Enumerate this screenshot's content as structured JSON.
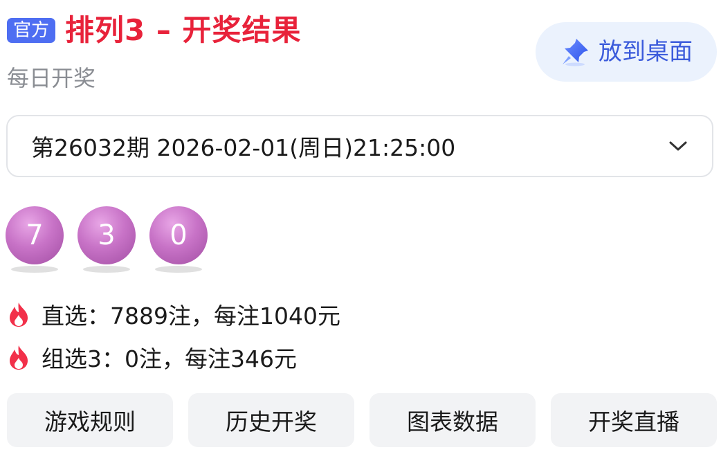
{
  "header": {
    "badge": "官方",
    "title": "排列3 – 开奖结果",
    "subtitle": "每日开奖"
  },
  "pin_button": {
    "label": "放到桌面",
    "icon": "pushpin-icon"
  },
  "issue_select": {
    "value": "第26032期 2026-02-01(周日)21:25:00",
    "icon": "chevron-down-icon"
  },
  "balls": [
    "7",
    "3",
    "0"
  ],
  "prizes": [
    {
      "icon": "fire-icon",
      "text": "直选：7889注，每注1040元"
    },
    {
      "icon": "fire-icon",
      "text": "组选3：0注，每注346元"
    }
  ],
  "actions": [
    "游戏规则",
    "历史开奖",
    "图表数据",
    "开奖直播"
  ],
  "colors": {
    "title_red": "#e8223a",
    "badge_blue": "#4e6ef2",
    "pin_bg": "#ebf2fd",
    "pin_text": "#3b5bdb",
    "ball_purple": "#c873c7",
    "fire_red": "#f2304a"
  }
}
